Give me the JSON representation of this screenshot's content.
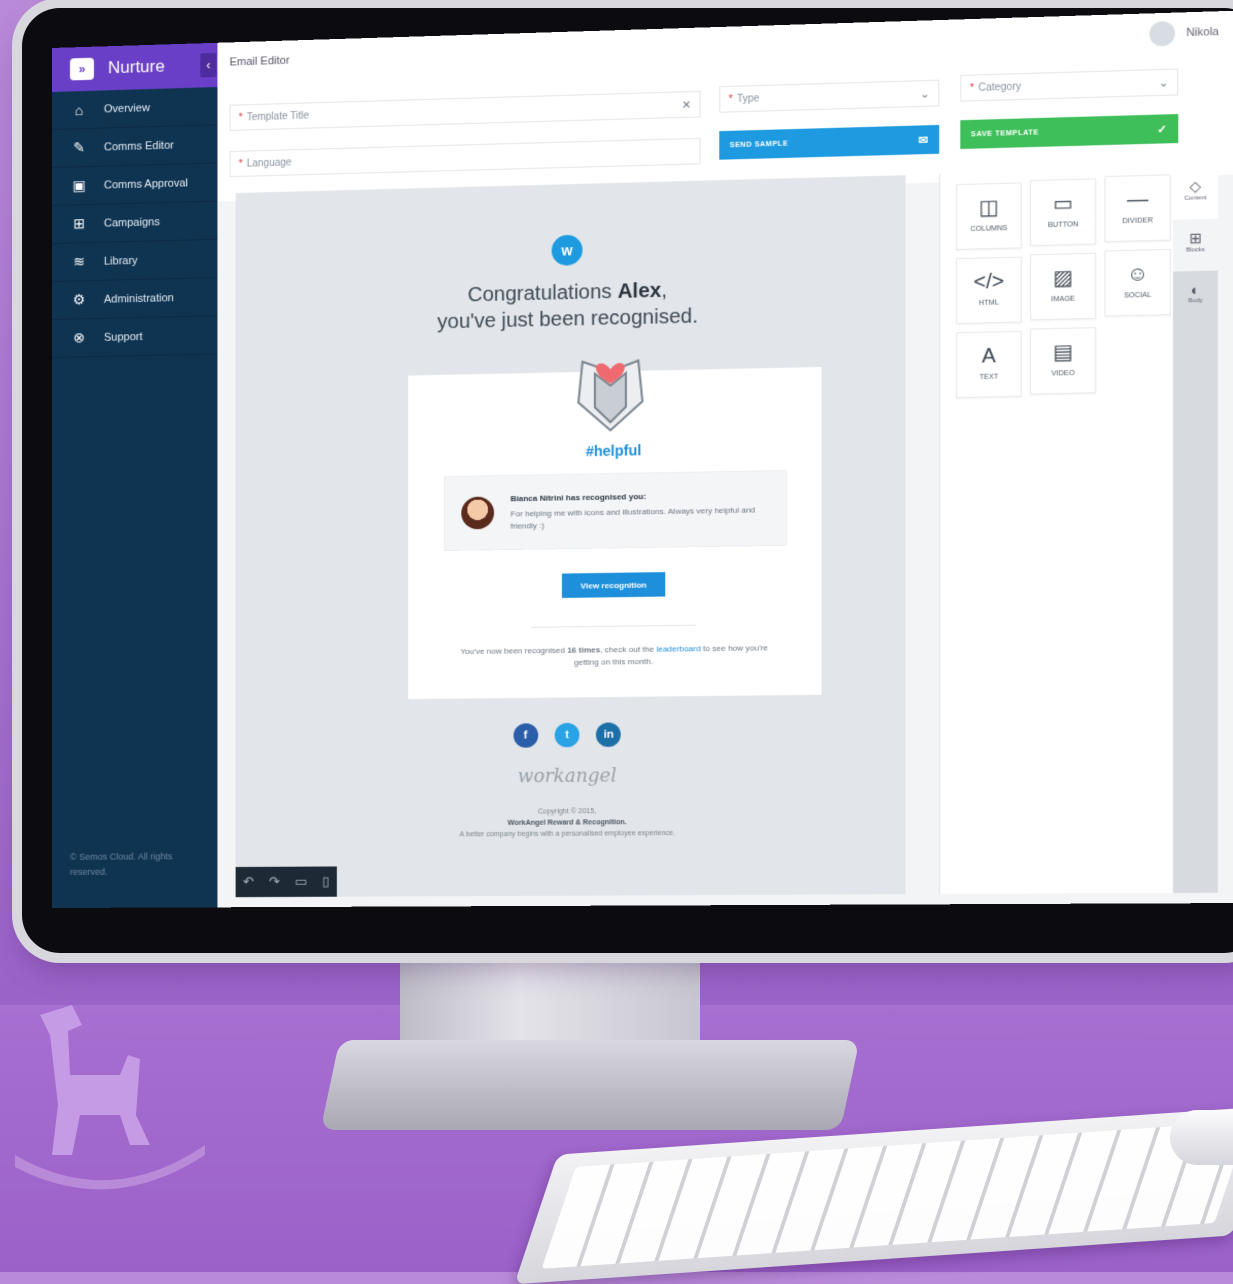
{
  "app": {
    "brand": "Nurture",
    "page_title": "Email Editor",
    "user": "Nikola"
  },
  "sidebar": {
    "items": [
      {
        "label": "Overview",
        "icon": "home-icon"
      },
      {
        "label": "Comms Editor",
        "icon": "edit-icon"
      },
      {
        "label": "Comms Approval",
        "icon": "clipboard-icon"
      },
      {
        "label": "Campaigns",
        "icon": "campaigns-icon"
      },
      {
        "label": "Library",
        "icon": "layers-icon"
      },
      {
        "label": "Administration",
        "icon": "gears-icon"
      },
      {
        "label": "Support",
        "icon": "lifebuoy-icon"
      }
    ],
    "footer": "© Semos Cloud. All rights reserved."
  },
  "form": {
    "template_title_placeholder": "Template Title",
    "language_placeholder": "Language",
    "type_placeholder": "Type",
    "category_placeholder": "Category",
    "send_sample_label": "SEND SAMPLE",
    "save_template_label": "SAVE TEMPLATE"
  },
  "email": {
    "headline_prefix": "Congratulations ",
    "headline_name": "Alex",
    "headline_suffix": ",",
    "headline_line2": "you've just been recognised.",
    "hashtag": "#helpful",
    "recognizer_line": "Bianca Nitrini has recognised you:",
    "recognition_message": "For helping me with icons and illustrations. Always very helpful and friendly :)",
    "view_button": "View recognition",
    "note_prefix": "You've now been recognised ",
    "note_count": "16 times",
    "note_middle": ", check out the ",
    "note_link": "leaderboard",
    "note_suffix": " to see how you're getting on this month.",
    "logo_text": "workangel",
    "copyright": "Copyright © 2015,",
    "company": "WorkAngel Reward & Recognition.",
    "tagline": "A better company begins with a personalised employee experience."
  },
  "blocks": [
    {
      "label": "COLUMNS",
      "icon": "columns-icon"
    },
    {
      "label": "BUTTON",
      "icon": "button-icon"
    },
    {
      "label": "DIVIDER",
      "icon": "divider-icon"
    },
    {
      "label": "HTML",
      "icon": "code-icon"
    },
    {
      "label": "IMAGE",
      "icon": "image-icon"
    },
    {
      "label": "SOCIAL",
      "icon": "social-icon"
    },
    {
      "label": "TEXT",
      "icon": "text-icon"
    },
    {
      "label": "VIDEO",
      "icon": "video-icon"
    }
  ],
  "panel_tabs": [
    {
      "label": "Content",
      "icon": "shapes-icon"
    },
    {
      "label": "Blocks",
      "icon": "grid-icon"
    },
    {
      "label": "Body",
      "icon": "palette-icon"
    }
  ],
  "colors": {
    "brand": "#6a3fc7",
    "sidebar": "#0f3452",
    "send_sample": "#1e9be0",
    "save_template": "#3fbf5a",
    "link": "#1e8fdb",
    "required": "#e0393e"
  }
}
